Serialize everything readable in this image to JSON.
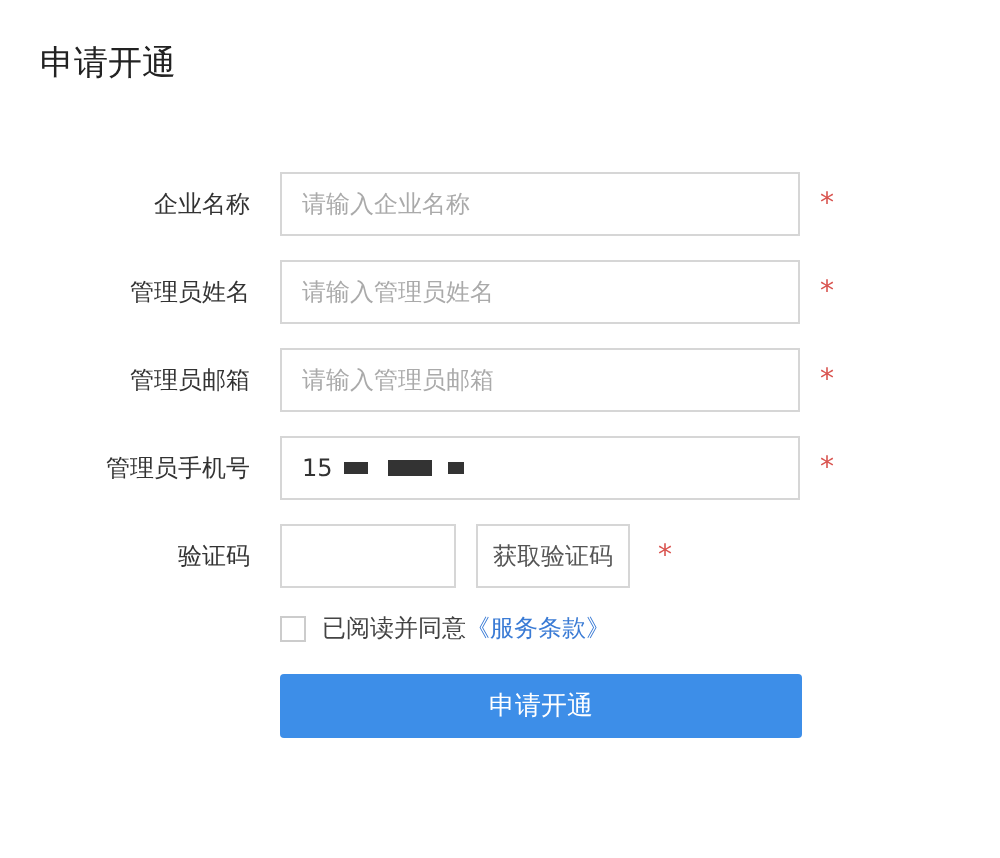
{
  "title": "申请开通",
  "fields": [
    {
      "label": "企业名称",
      "placeholder": "请输入企业名称",
      "required_mark": "*"
    },
    {
      "label": "管理员姓名",
      "placeholder": "请输入管理员姓名",
      "required_mark": "*"
    },
    {
      "label": "管理员邮箱",
      "placeholder": "请输入管理员邮箱",
      "required_mark": "*"
    },
    {
      "label": "管理员手机号",
      "value": "15",
      "redacted": true,
      "required_mark": "*"
    }
  ],
  "captcha": {
    "label": "验证码",
    "button": "获取验证码",
    "required_mark": "*"
  },
  "agreement": {
    "checked": false,
    "text": "已阅读并同意",
    "link": "《服务条款》"
  },
  "submit": "申请开通"
}
